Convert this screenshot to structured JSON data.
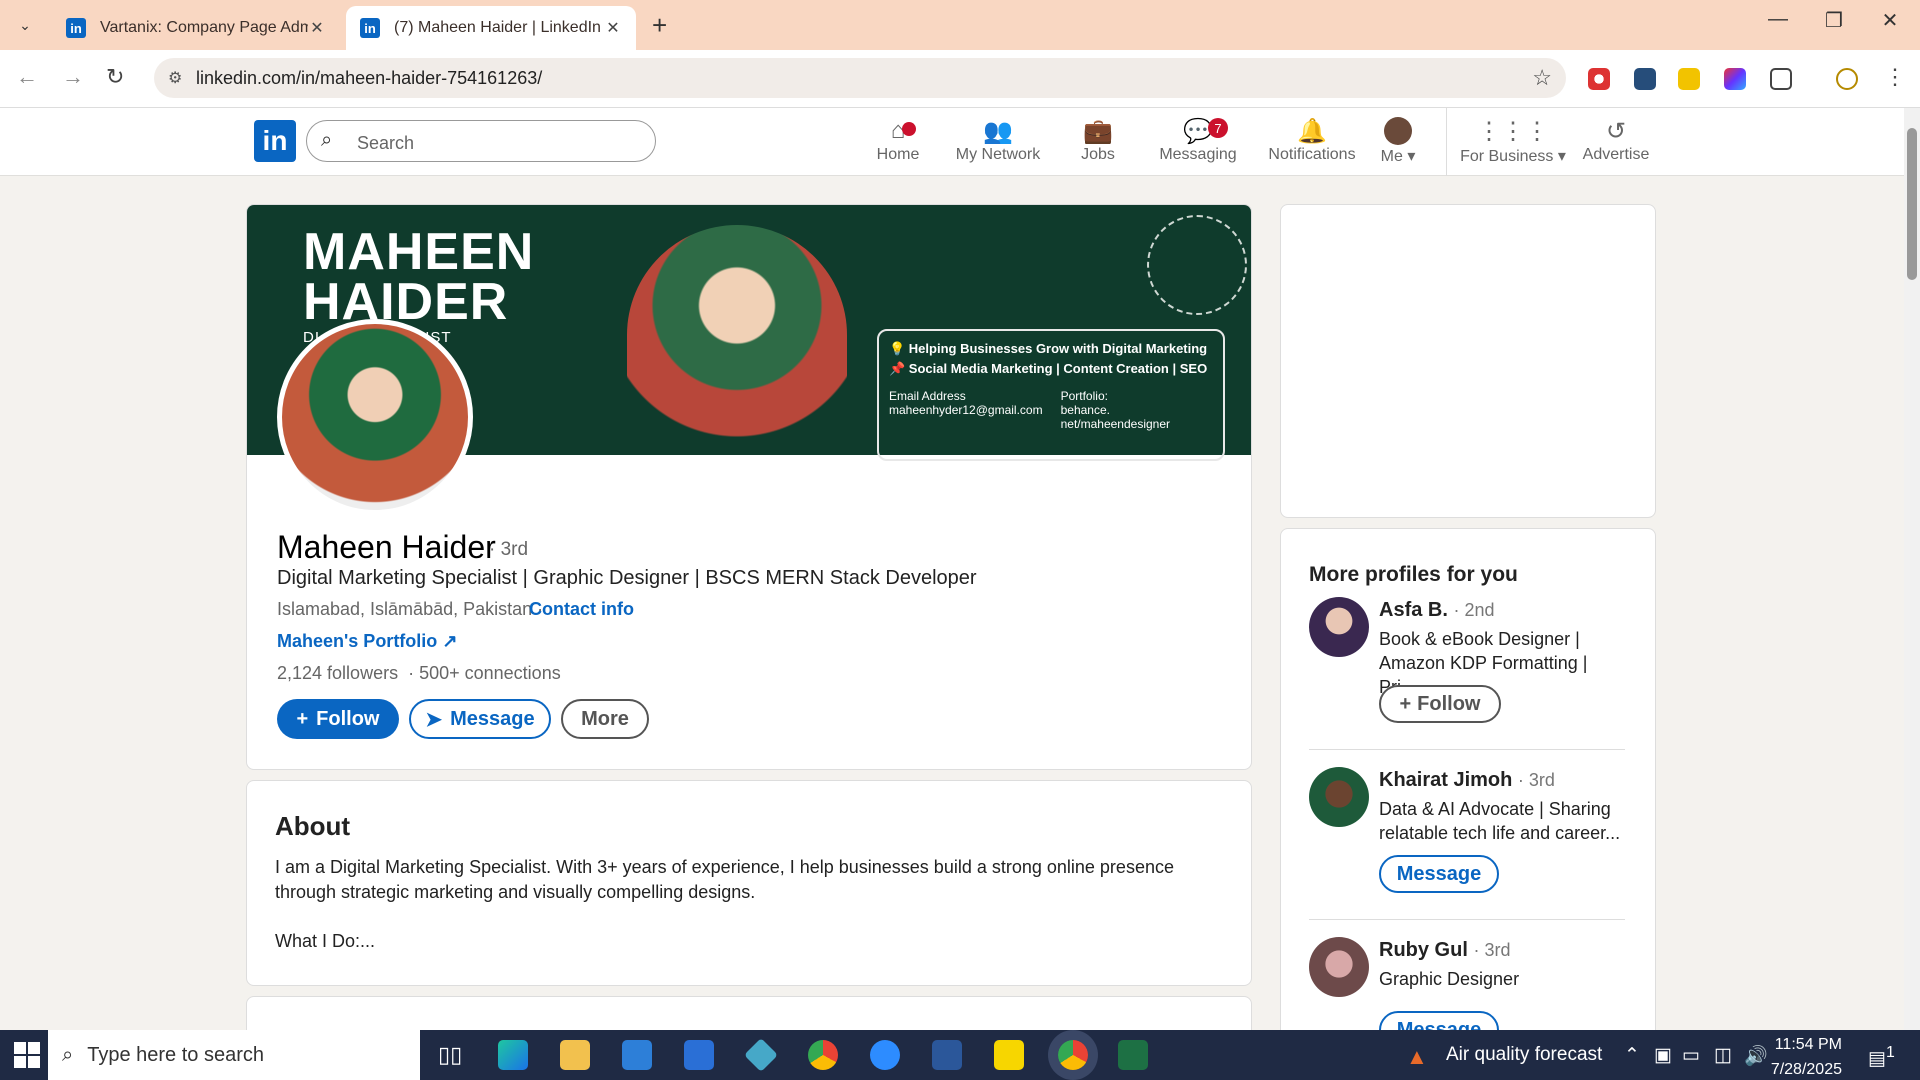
{
  "browser": {
    "tabs": [
      {
        "title": "Vartanix: Company Page Admin",
        "active": false
      },
      {
        "title": "(7) Maheen Haider | LinkedIn",
        "active": true
      }
    ],
    "url": "linkedin.com/in/maheen-haider-754161263/"
  },
  "linkedin": {
    "search_placeholder": "Search",
    "nav": [
      {
        "label": "Home",
        "icon": "home-icon",
        "badge": ""
      },
      {
        "label": "My Network",
        "icon": "network-icon",
        "badge": ""
      },
      {
        "label": "Jobs",
        "icon": "briefcase-icon",
        "badge": ""
      },
      {
        "label": "Messaging",
        "icon": "chat-icon",
        "badge": "7"
      },
      {
        "label": "Notifications",
        "icon": "bell-icon",
        "badge": ""
      },
      {
        "label": "Me",
        "icon": "avatar-icon",
        "badge": ""
      },
      {
        "label": "For Business",
        "icon": "grid-icon",
        "badge": ""
      },
      {
        "label": "Advertise",
        "icon": "advertise-icon",
        "badge": ""
      }
    ]
  },
  "banner": {
    "name_line1": "MAHEEN",
    "name_line2": "HAIDER",
    "role": "DI         NG SPECIALIST",
    "line1": "💡 Helping Businesses Grow with Digital Marketing",
    "line2": "📌 Social Media Marketing | Content Creation | SEO",
    "email_label": "Email Address",
    "email": "maheenhyder12@gmail.com",
    "portfolio_label": "Portfolio:",
    "portfolio": "behance. net/maheendesigner"
  },
  "profile": {
    "name": "Maheen Haider",
    "degree": "· 3rd",
    "headline": "Digital Marketing Specialist | Graphic Designer | BSCS MERN Stack Developer",
    "location": "Islamabad, Islāmābād, Pakistan ·",
    "contact_info": "Contact info",
    "portfolio_link": "Maheen's Portfolio",
    "followers": "2,124 followers",
    "connections": "· 500+ connections",
    "follow_btn": "Follow",
    "message_btn": "Message",
    "more_btn": "More"
  },
  "about": {
    "heading": "About",
    "text": "I am a Digital Marketing Specialist. With 3+ years of experience, I help businesses build a strong online presence through strategic marketing and visually compelling designs.",
    "text2": "What I Do:..."
  },
  "more_profiles": {
    "heading": "More profiles for you",
    "items": [
      {
        "name": "Asfa B.",
        "degree": "· 2nd",
        "desc": "Book & eBook Designer | Amazon KDP Formatting | Pri...",
        "button": "Follow"
      },
      {
        "name": "Khairat Jimoh",
        "degree": "· 3rd",
        "desc": "Data & AI Advocate | Sharing relatable tech life and career...",
        "button": "Message"
      },
      {
        "name": "Ruby Gul",
        "degree": "· 3rd",
        "desc": "Graphic Designer",
        "button": "Message"
      }
    ]
  },
  "taskbar": {
    "search_placeholder": "Type here to search",
    "weather": "Air quality forecast",
    "time": "11:54 PM",
    "date": "7/28/2025",
    "notif_count": "1"
  },
  "colors": {
    "accent": "#0a66c2",
    "tabstrip": "#f9d7c2",
    "banner": "#0f3b2c"
  }
}
